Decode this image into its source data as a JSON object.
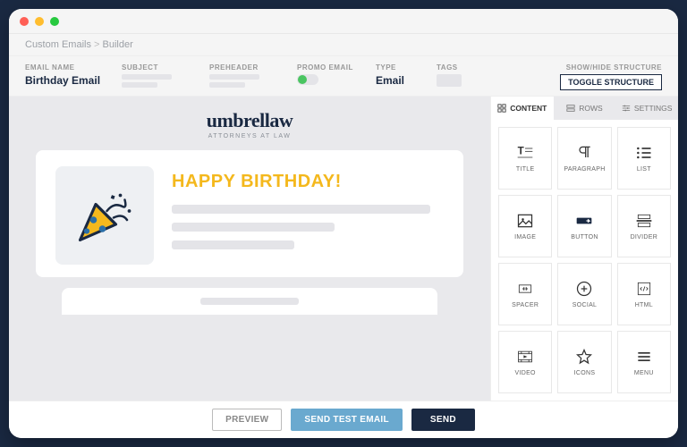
{
  "breadcrumb": {
    "root": "Custom Emails",
    "current": "Builder"
  },
  "meta": {
    "name_label": "EMAIL NAME",
    "name_value": "Birthday Email",
    "subject_label": "SUBJECT",
    "preheader_label": "PREHEADER",
    "promo_label": "PROMO EMAIL",
    "type_label": "TYPE",
    "type_value": "Email",
    "tags_label": "TAGS",
    "structure_label": "SHOW/HIDE STRUCTURE",
    "toggle_btn": "TOGGLE STRUCTURE"
  },
  "canvas": {
    "brand": "umbrellaw",
    "brand_sub": "ATTORNEYS AT LAW",
    "headline": "HAPPY BIRTHDAY!"
  },
  "tabs": {
    "content": "CONTENT",
    "rows": "ROWS",
    "settings": "SETTINGS"
  },
  "tiles": [
    {
      "key": "title",
      "label": "TITLE"
    },
    {
      "key": "paragraph",
      "label": "PARAGRAPH"
    },
    {
      "key": "list",
      "label": "LIST"
    },
    {
      "key": "image",
      "label": "IMAGE"
    },
    {
      "key": "button",
      "label": "BUTTON"
    },
    {
      "key": "divider",
      "label": "DIVIDER"
    },
    {
      "key": "spacer",
      "label": "SPACER"
    },
    {
      "key": "social",
      "label": "SOCIAL"
    },
    {
      "key": "html",
      "label": "HTML"
    },
    {
      "key": "video",
      "label": "VIDEO"
    },
    {
      "key": "icons",
      "label": "ICONS"
    },
    {
      "key": "menu",
      "label": "MENU"
    }
  ],
  "footer": {
    "preview": "PREVIEW",
    "test": "SEND TEST EMAIL",
    "send": "SEND"
  },
  "colors": {
    "accent": "#f4b81d",
    "navy": "#1a2942",
    "button_blue": "#6aa9cf"
  }
}
